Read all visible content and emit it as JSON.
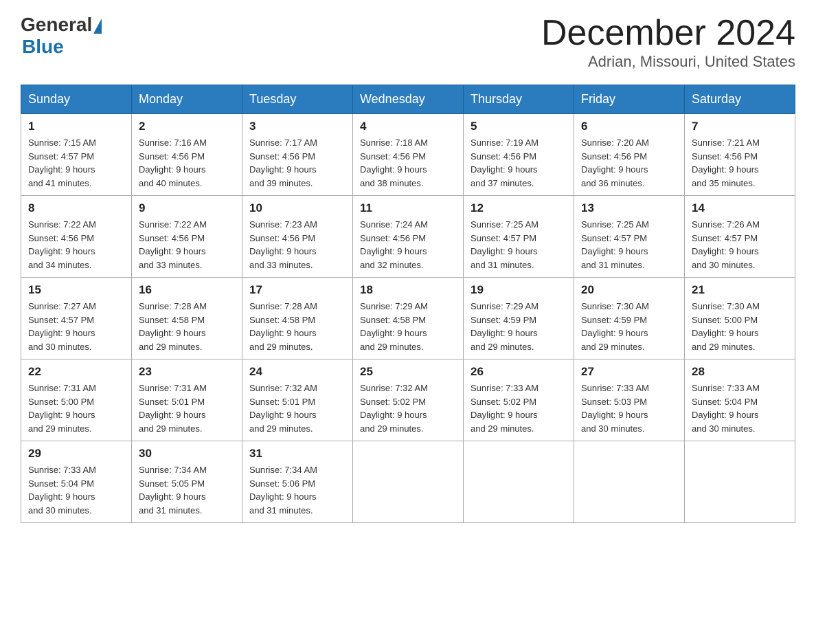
{
  "header": {
    "logo_general": "General",
    "logo_blue": "Blue",
    "month_title": "December 2024",
    "location": "Adrian, Missouri, United States"
  },
  "days_of_week": [
    "Sunday",
    "Monday",
    "Tuesday",
    "Wednesday",
    "Thursday",
    "Friday",
    "Saturday"
  ],
  "weeks": [
    [
      {
        "day": "1",
        "sunrise": "7:15 AM",
        "sunset": "4:57 PM",
        "daylight": "9 hours and 41 minutes."
      },
      {
        "day": "2",
        "sunrise": "7:16 AM",
        "sunset": "4:56 PM",
        "daylight": "9 hours and 40 minutes."
      },
      {
        "day": "3",
        "sunrise": "7:17 AM",
        "sunset": "4:56 PM",
        "daylight": "9 hours and 39 minutes."
      },
      {
        "day": "4",
        "sunrise": "7:18 AM",
        "sunset": "4:56 PM",
        "daylight": "9 hours and 38 minutes."
      },
      {
        "day": "5",
        "sunrise": "7:19 AM",
        "sunset": "4:56 PM",
        "daylight": "9 hours and 37 minutes."
      },
      {
        "day": "6",
        "sunrise": "7:20 AM",
        "sunset": "4:56 PM",
        "daylight": "9 hours and 36 minutes."
      },
      {
        "day": "7",
        "sunrise": "7:21 AM",
        "sunset": "4:56 PM",
        "daylight": "9 hours and 35 minutes."
      }
    ],
    [
      {
        "day": "8",
        "sunrise": "7:22 AM",
        "sunset": "4:56 PM",
        "daylight": "9 hours and 34 minutes."
      },
      {
        "day": "9",
        "sunrise": "7:22 AM",
        "sunset": "4:56 PM",
        "daylight": "9 hours and 33 minutes."
      },
      {
        "day": "10",
        "sunrise": "7:23 AM",
        "sunset": "4:56 PM",
        "daylight": "9 hours and 33 minutes."
      },
      {
        "day": "11",
        "sunrise": "7:24 AM",
        "sunset": "4:56 PM",
        "daylight": "9 hours and 32 minutes."
      },
      {
        "day": "12",
        "sunrise": "7:25 AM",
        "sunset": "4:57 PM",
        "daylight": "9 hours and 31 minutes."
      },
      {
        "day": "13",
        "sunrise": "7:25 AM",
        "sunset": "4:57 PM",
        "daylight": "9 hours and 31 minutes."
      },
      {
        "day": "14",
        "sunrise": "7:26 AM",
        "sunset": "4:57 PM",
        "daylight": "9 hours and 30 minutes."
      }
    ],
    [
      {
        "day": "15",
        "sunrise": "7:27 AM",
        "sunset": "4:57 PM",
        "daylight": "9 hours and 30 minutes."
      },
      {
        "day": "16",
        "sunrise": "7:28 AM",
        "sunset": "4:58 PM",
        "daylight": "9 hours and 29 minutes."
      },
      {
        "day": "17",
        "sunrise": "7:28 AM",
        "sunset": "4:58 PM",
        "daylight": "9 hours and 29 minutes."
      },
      {
        "day": "18",
        "sunrise": "7:29 AM",
        "sunset": "4:58 PM",
        "daylight": "9 hours and 29 minutes."
      },
      {
        "day": "19",
        "sunrise": "7:29 AM",
        "sunset": "4:59 PM",
        "daylight": "9 hours and 29 minutes."
      },
      {
        "day": "20",
        "sunrise": "7:30 AM",
        "sunset": "4:59 PM",
        "daylight": "9 hours and 29 minutes."
      },
      {
        "day": "21",
        "sunrise": "7:30 AM",
        "sunset": "5:00 PM",
        "daylight": "9 hours and 29 minutes."
      }
    ],
    [
      {
        "day": "22",
        "sunrise": "7:31 AM",
        "sunset": "5:00 PM",
        "daylight": "9 hours and 29 minutes."
      },
      {
        "day": "23",
        "sunrise": "7:31 AM",
        "sunset": "5:01 PM",
        "daylight": "9 hours and 29 minutes."
      },
      {
        "day": "24",
        "sunrise": "7:32 AM",
        "sunset": "5:01 PM",
        "daylight": "9 hours and 29 minutes."
      },
      {
        "day": "25",
        "sunrise": "7:32 AM",
        "sunset": "5:02 PM",
        "daylight": "9 hours and 29 minutes."
      },
      {
        "day": "26",
        "sunrise": "7:33 AM",
        "sunset": "5:02 PM",
        "daylight": "9 hours and 29 minutes."
      },
      {
        "day": "27",
        "sunrise": "7:33 AM",
        "sunset": "5:03 PM",
        "daylight": "9 hours and 30 minutes."
      },
      {
        "day": "28",
        "sunrise": "7:33 AM",
        "sunset": "5:04 PM",
        "daylight": "9 hours and 30 minutes."
      }
    ],
    [
      {
        "day": "29",
        "sunrise": "7:33 AM",
        "sunset": "5:04 PM",
        "daylight": "9 hours and 30 minutes."
      },
      {
        "day": "30",
        "sunrise": "7:34 AM",
        "sunset": "5:05 PM",
        "daylight": "9 hours and 31 minutes."
      },
      {
        "day": "31",
        "sunrise": "7:34 AM",
        "sunset": "5:06 PM",
        "daylight": "9 hours and 31 minutes."
      },
      null,
      null,
      null,
      null
    ]
  ],
  "labels": {
    "sunrise": "Sunrise:",
    "sunset": "Sunset:",
    "daylight": "Daylight:"
  }
}
